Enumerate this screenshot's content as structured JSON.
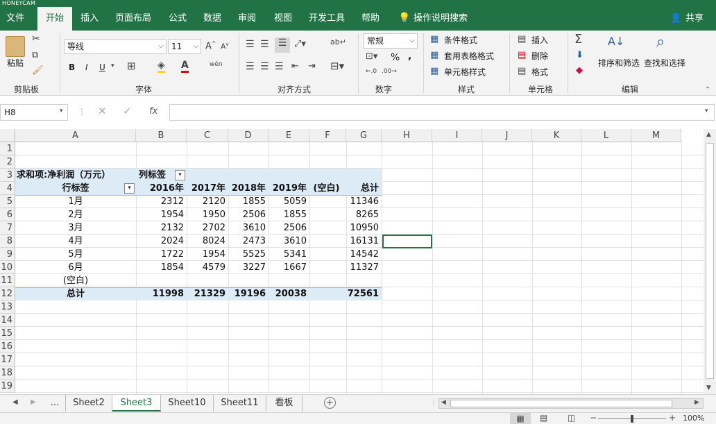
{
  "watermark": "HONEYCAM",
  "ribbon_tabs": [
    {
      "label": "文件"
    },
    {
      "label": "开始"
    },
    {
      "label": "插入"
    },
    {
      "label": "页面布局"
    },
    {
      "label": "公式"
    },
    {
      "label": "数据"
    },
    {
      "label": "审阅"
    },
    {
      "label": "视图"
    },
    {
      "label": "开发工具"
    },
    {
      "label": "帮助"
    }
  ],
  "tell_me": "操作说明搜索",
  "share": "共享",
  "clipboard": {
    "paste": "粘贴",
    "group": "剪贴板"
  },
  "font": {
    "name": "等线",
    "size": "11",
    "group": "字体",
    "bold": "B",
    "italic": "I",
    "underline": "U"
  },
  "align": {
    "group": "对齐方式"
  },
  "number": {
    "format": "常规",
    "percent": "%",
    "comma": ",",
    "group": "数字"
  },
  "styles": {
    "cond": "条件格式",
    "table": "套用表格格式",
    "cell": "单元格样式",
    "group": "样式"
  },
  "cells": {
    "insert": "插入",
    "delete": "删除",
    "format": "格式",
    "group": "单元格"
  },
  "editing": {
    "sort": "排序和筛选",
    "find": "查找和选择",
    "group": "编辑"
  },
  "namebox": "H8",
  "columns": [
    {
      "label": "A"
    },
    {
      "label": "B"
    },
    {
      "label": "C"
    },
    {
      "label": "D"
    },
    {
      "label": "E"
    },
    {
      "label": "F"
    },
    {
      "label": "G"
    },
    {
      "label": "H"
    },
    {
      "label": "I"
    },
    {
      "label": "J"
    },
    {
      "label": "K"
    },
    {
      "label": "L"
    },
    {
      "label": "M"
    }
  ],
  "rows": [
    "1",
    "2",
    "3",
    "4",
    "5",
    "6",
    "7",
    "8",
    "9",
    "10",
    "11",
    "12",
    "13",
    "14",
    "15",
    "16",
    "17",
    "18",
    "19"
  ],
  "pivot": {
    "sum_label": "求和项:净利润（万元）",
    "col_label": "列标签",
    "row_label": "行标签",
    "headers": [
      "2016年",
      "2017年",
      "2018年",
      "2019年",
      "(空白)",
      "总计"
    ],
    "data": [
      {
        "label": "1月",
        "values": [
          "2312",
          "2120",
          "1855",
          "5059",
          "",
          "11346"
        ]
      },
      {
        "label": "2月",
        "values": [
          "1954",
          "1950",
          "2506",
          "1855",
          "",
          "8265"
        ]
      },
      {
        "label": "3月",
        "values": [
          "2132",
          "2702",
          "3610",
          "2506",
          "",
          "10950"
        ]
      },
      {
        "label": "4月",
        "values": [
          "2024",
          "8024",
          "2473",
          "3610",
          "",
          "16131"
        ]
      },
      {
        "label": "5月",
        "values": [
          "1722",
          "1954",
          "5525",
          "5341",
          "",
          "14542"
        ]
      },
      {
        "label": "6月",
        "values": [
          "1854",
          "4579",
          "3227",
          "1667",
          "",
          "11327"
        ]
      },
      {
        "label": "(空白)",
        "values": [
          "",
          "",
          "",
          "",
          "",
          ""
        ]
      }
    ],
    "total_label": "总计",
    "totals": [
      "11998",
      "21329",
      "19196",
      "20038",
      "",
      "72561"
    ]
  },
  "sheets": [
    {
      "label": "Sheet2"
    },
    {
      "label": "Sheet3"
    },
    {
      "label": "Sheet10"
    },
    {
      "label": "Sheet11"
    },
    {
      "label": "看板"
    }
  ],
  "sheet_more": "...",
  "zoom": "100%",
  "accent": "#217346"
}
